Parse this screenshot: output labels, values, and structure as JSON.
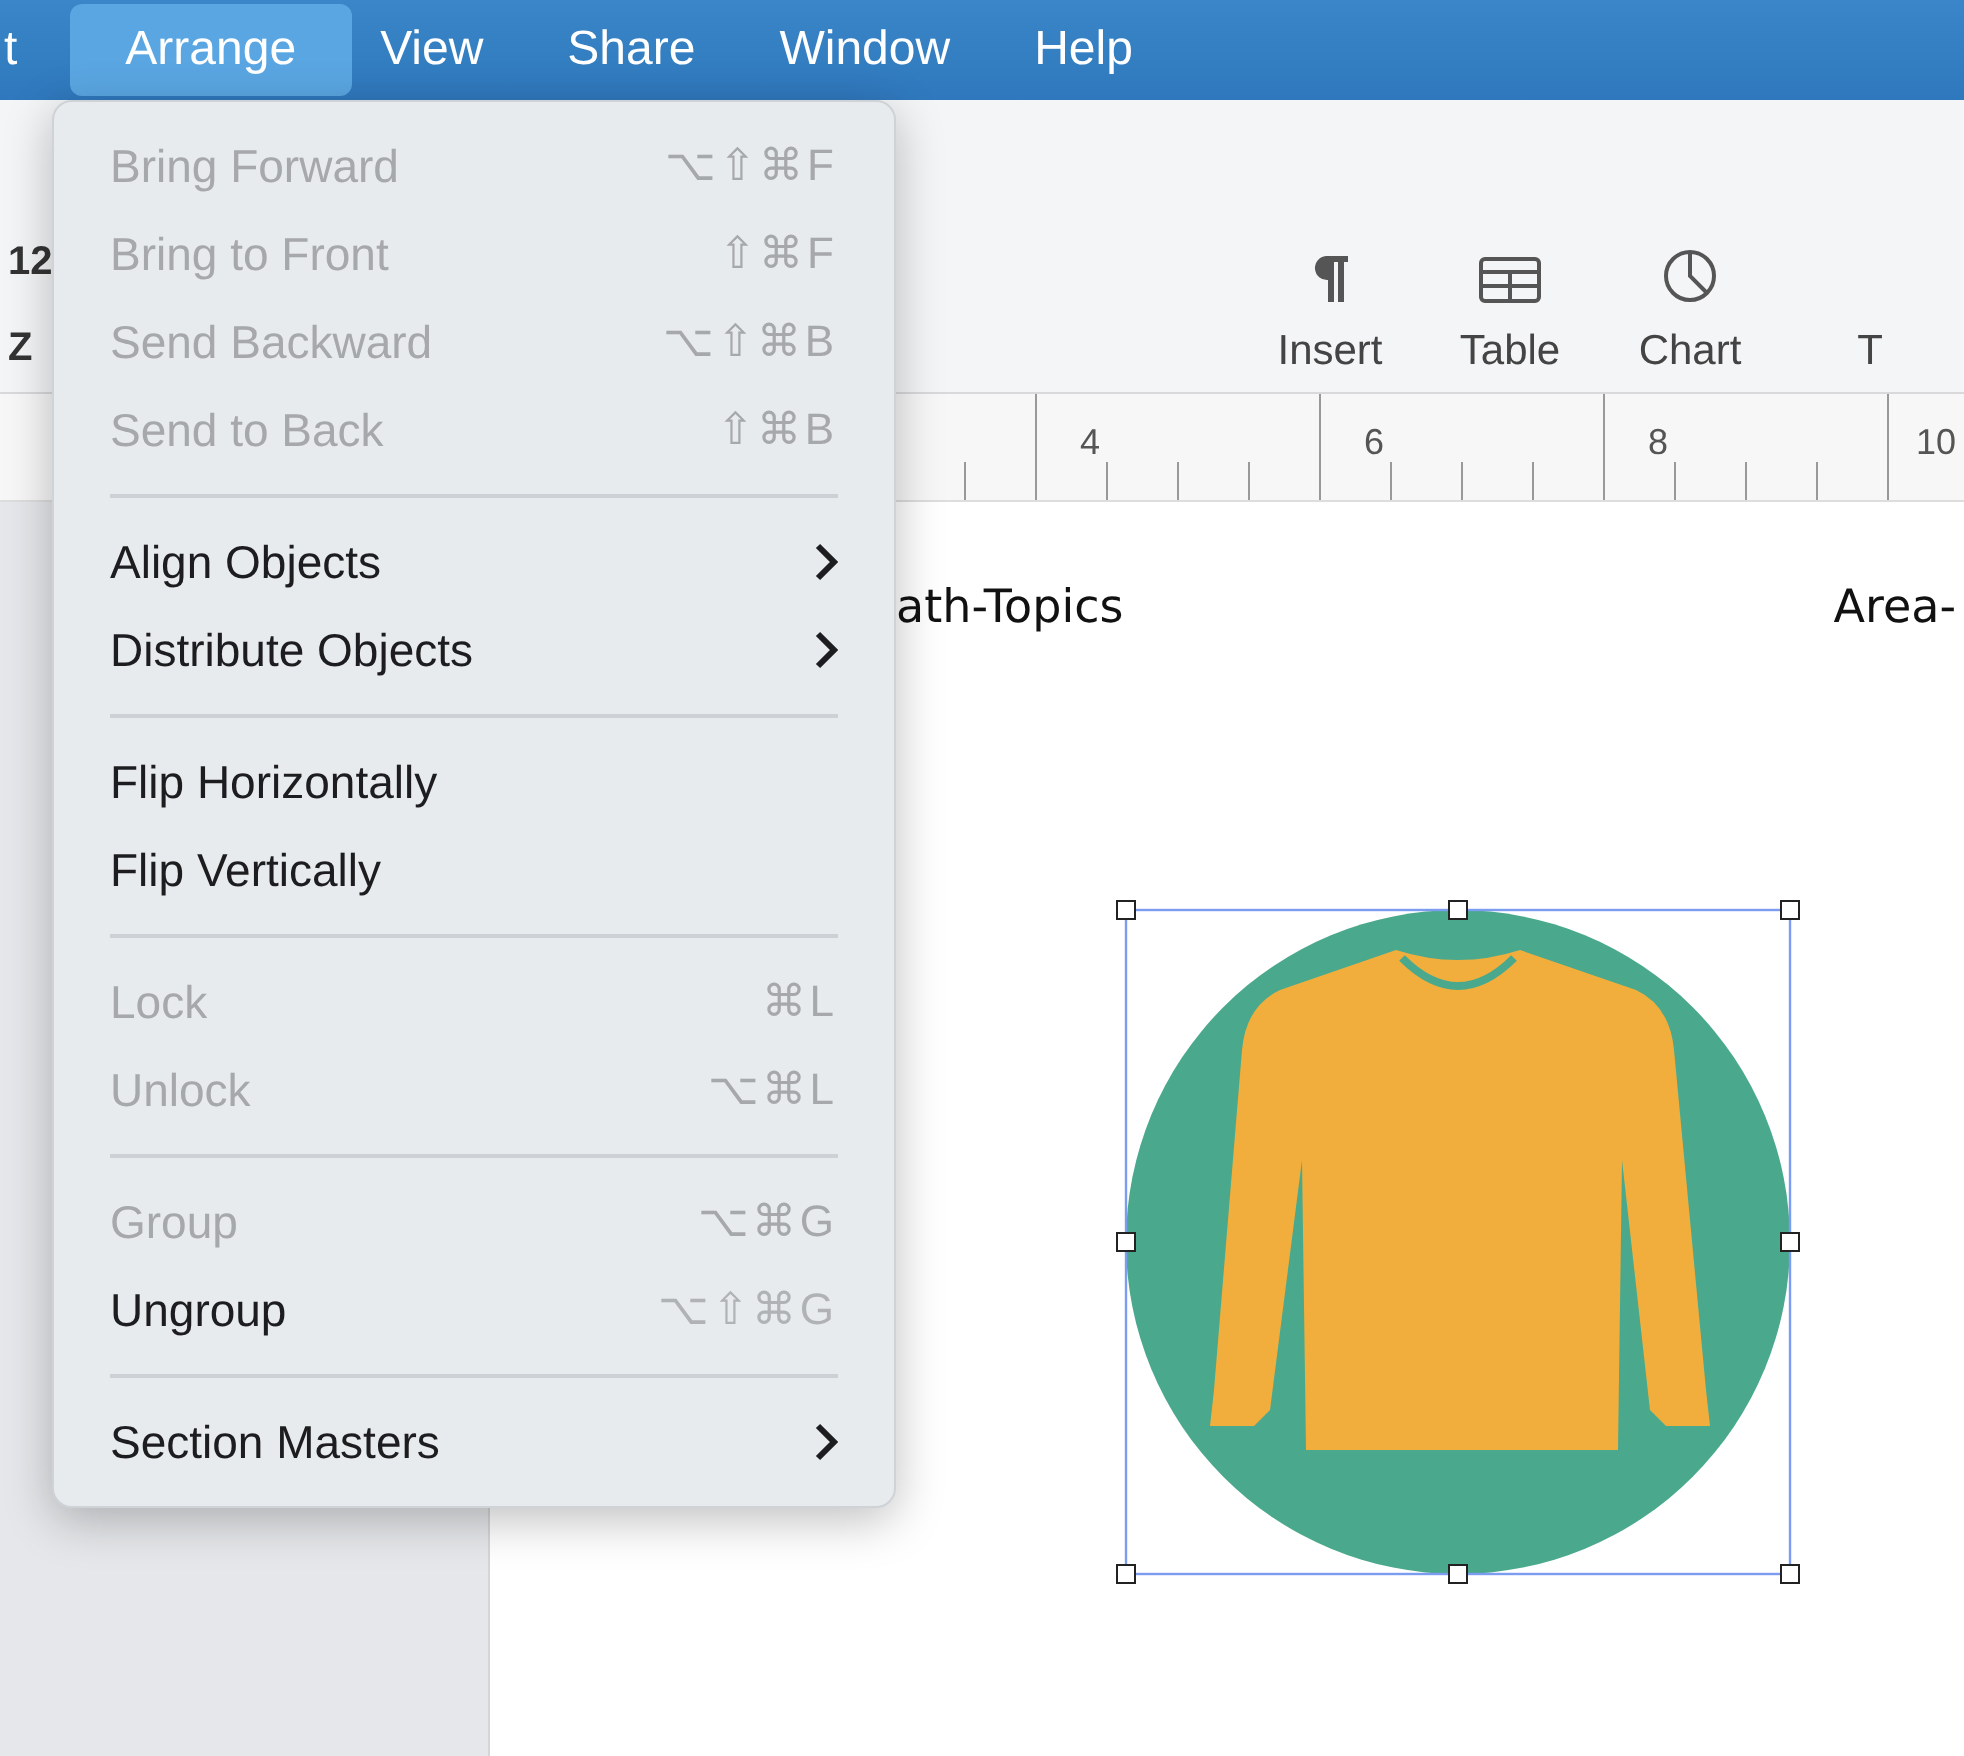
{
  "menu_bar": [
    {
      "label": "t",
      "selected": false
    },
    {
      "label": "Arrange",
      "selected": true
    },
    {
      "label": "View",
      "selected": false
    },
    {
      "label": "Share",
      "selected": false
    },
    {
      "label": "Window",
      "selected": false
    },
    {
      "label": "Help",
      "selected": false
    }
  ],
  "toolbar": {
    "left_texts": [
      "12",
      "Z"
    ],
    "buttons": [
      {
        "label": "Insert",
        "kind": "paragraph"
      },
      {
        "label": "Table",
        "kind": "table"
      },
      {
        "label": "Chart",
        "kind": "chart"
      },
      {
        "label": "T",
        "kind": "text"
      }
    ]
  },
  "ruler": {
    "labels": [
      "4",
      "6",
      "8",
      "10"
    ]
  },
  "document": {
    "header_left": "ath-Topics",
    "header_right": "Area-",
    "image": {
      "kind": "picture",
      "selected": true
    }
  },
  "arrange_menu": {
    "sections": [
      {
        "items": [
          {
            "label": "Bring Forward",
            "shortcut": "⌥⇧⌘F",
            "disabled": true,
            "submenu": false
          },
          {
            "label": "Bring to Front",
            "shortcut": "⇧⌘F",
            "disabled": true,
            "submenu": false
          },
          {
            "label": "Send Backward",
            "shortcut": "⌥⇧⌘B",
            "disabled": true,
            "submenu": false
          },
          {
            "label": "Send to Back",
            "shortcut": "⇧⌘B",
            "disabled": true,
            "submenu": false
          }
        ]
      },
      {
        "items": [
          {
            "label": "Align Objects",
            "disabled": false,
            "submenu": true
          },
          {
            "label": "Distribute Objects",
            "disabled": false,
            "submenu": true
          }
        ]
      },
      {
        "items": [
          {
            "label": "Flip Horizontally",
            "disabled": false,
            "submenu": false
          },
          {
            "label": "Flip Vertically",
            "disabled": false,
            "submenu": false
          }
        ]
      },
      {
        "items": [
          {
            "label": "Lock",
            "shortcut": "⌘L",
            "disabled": true,
            "submenu": false
          },
          {
            "label": "Unlock",
            "shortcut": "⌥⌘L",
            "disabled": true,
            "submenu": false
          }
        ]
      },
      {
        "items": [
          {
            "label": "Group",
            "shortcut": "⌥⌘G",
            "disabled": true,
            "submenu": false
          },
          {
            "label": "Ungroup",
            "shortcut": "⌥⇧⌘G",
            "disabled": false,
            "submenu": false
          }
        ]
      },
      {
        "items": [
          {
            "label": "Section Masters",
            "disabled": false,
            "submenu": true
          }
        ]
      }
    ]
  }
}
